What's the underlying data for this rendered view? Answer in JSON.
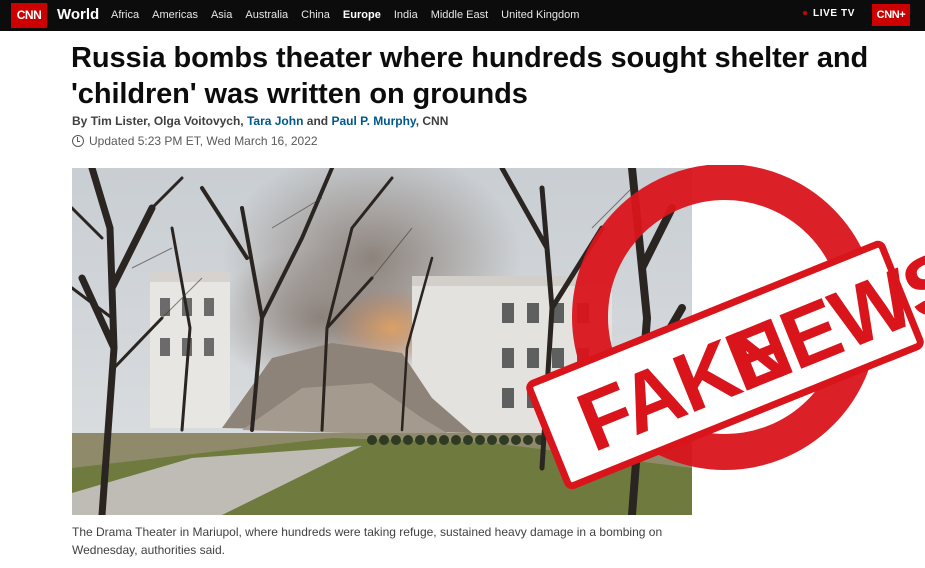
{
  "nav": {
    "logo": "CNN",
    "section": "World",
    "items": [
      "Africa",
      "Americas",
      "Asia",
      "Australia",
      "China",
      "Europe",
      "India",
      "Middle East",
      "United Kingdom"
    ],
    "active_item": "Europe",
    "live_tv": "LIVE TV",
    "cnn_plus": "CNN+"
  },
  "article": {
    "headline": "Russia bombs theater where hundreds sought shelter and 'children' was written on grounds",
    "byline_prefix": "By ",
    "authors": [
      "Tim Lister",
      "Olga Voitovych",
      "Tara John",
      "Paul P. Murphy"
    ],
    "authors_linked": [
      false,
      false,
      true,
      true
    ],
    "byline_suffix": "CNN",
    "updated": "Updated 5:23 PM ET, Wed March 16, 2022",
    "caption": "The Drama Theater in Mariupol, where hundreds were taking refuge, sustained heavy damage in a bombing on Wednesday, authorities said."
  },
  "stamp": {
    "text_1": "FAKE",
    "text_2": "NEWS",
    "color": "#d9141b"
  },
  "colors": {
    "nav_bg": "#0c0c0c",
    "brand_red": "#cc0000",
    "link_blue": "#00578a"
  }
}
